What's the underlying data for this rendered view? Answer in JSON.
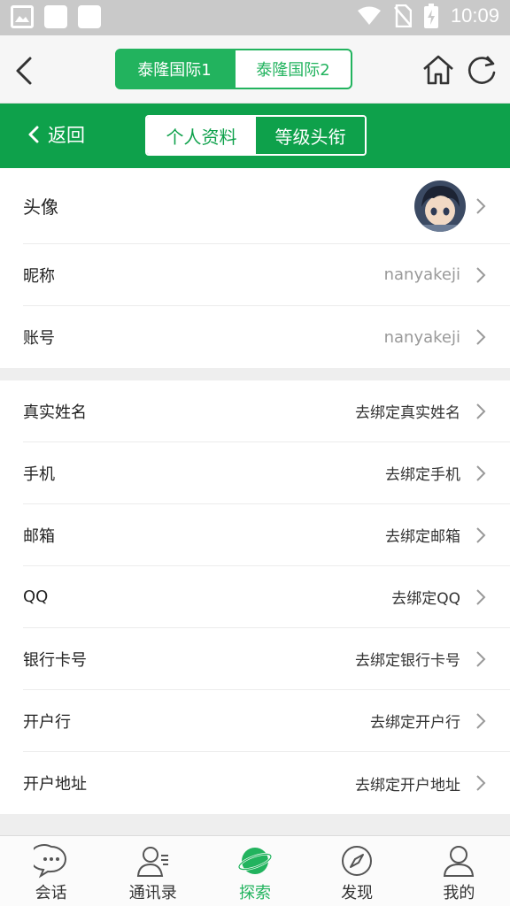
{
  "status_bar": {
    "time": "10:09"
  },
  "browser_tabs": [
    {
      "label": "泰隆国际1",
      "active": true
    },
    {
      "label": "泰隆国际2",
      "active": false
    }
  ],
  "header": {
    "back_label": "返回",
    "segments": [
      {
        "label": "个人资料",
        "selected": true
      },
      {
        "label": "等级头衔",
        "selected": false
      }
    ]
  },
  "profile": {
    "avatar_label": "头像",
    "nickname": {
      "label": "昵称",
      "value": "nanyakeji"
    },
    "account": {
      "label": "账号",
      "value": "nanyakeji"
    }
  },
  "bindings": [
    {
      "label": "真实姓名",
      "value": "去绑定真实姓名"
    },
    {
      "label": "手机",
      "value": "去绑定手机"
    },
    {
      "label": "邮箱",
      "value": "去绑定邮箱"
    },
    {
      "label": "QQ",
      "value": "去绑定QQ"
    },
    {
      "label": "银行卡号",
      "value": "去绑定银行卡号"
    },
    {
      "label": "开户行",
      "value": "去绑定开户行"
    },
    {
      "label": "开户地址",
      "value": "去绑定开户地址"
    }
  ],
  "tabbar": [
    {
      "label": "会话",
      "icon": "chat-bubble-icon"
    },
    {
      "label": "通讯录",
      "icon": "contacts-icon"
    },
    {
      "label": "探索",
      "icon": "planet-icon",
      "active": true
    },
    {
      "label": "发现",
      "icon": "compass-icon"
    },
    {
      "label": "我的",
      "icon": "person-icon"
    }
  ],
  "colors": {
    "brand_green": "#0ea14b",
    "tab_green": "#22b35e"
  }
}
